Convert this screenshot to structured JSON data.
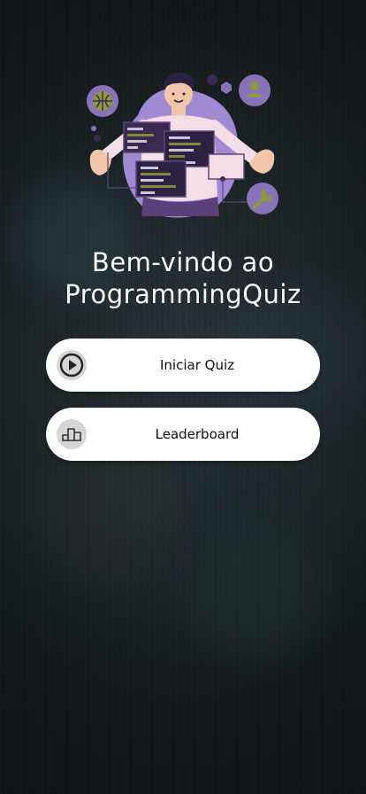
{
  "app": {
    "title_line1": "Bem-vindo ao",
    "title_line2": "ProgrammingQuiz"
  },
  "buttons": {
    "start": {
      "label": "Iniciar Quiz",
      "icon": "play-icon"
    },
    "leaderboard": {
      "label": "Leaderboard",
      "icon": "podium-icon"
    }
  },
  "colors": {
    "button_background": "#ffffff",
    "icon_background": "#d5d5d5",
    "illustration_purple": "#9b85c9",
    "illustration_green": "#7a8c3a"
  }
}
